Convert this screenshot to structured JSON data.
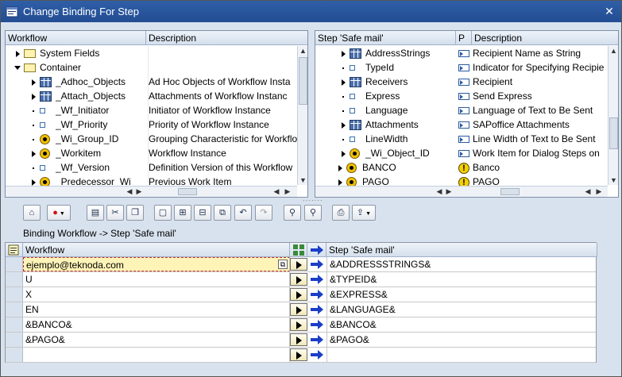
{
  "window": {
    "title": "Change Binding For Step"
  },
  "left_tree": {
    "columns": [
      "Workflow",
      "Description"
    ],
    "rows": [
      {
        "icon": "folder",
        "expander": "collapsed",
        "indent": 1,
        "name": "System Fields",
        "desc": ""
      },
      {
        "icon": "folder",
        "expander": "expanded",
        "indent": 1,
        "name": "Container",
        "desc": ""
      },
      {
        "icon": "table",
        "expander": "collapsed",
        "indent": 2,
        "name": "_Adhoc_Objects",
        "desc": "Ad Hoc Objects of Workflow Insta"
      },
      {
        "icon": "table",
        "expander": "collapsed",
        "indent": 2,
        "name": "_Attach_Objects",
        "desc": "Attachments of Workflow Instanc"
      },
      {
        "icon": "element",
        "expander": "leaf",
        "indent": 2,
        "name": "_Wf_Initiator",
        "desc": "Initiator of Workflow Instance"
      },
      {
        "icon": "element",
        "expander": "leaf",
        "indent": 2,
        "name": "_Wf_Priority",
        "desc": "Priority of Workflow Instance"
      },
      {
        "icon": "object",
        "expander": "leaf",
        "indent": 2,
        "name": "_Wi_Group_ID",
        "desc": "Grouping Characteristic for Workflo"
      },
      {
        "icon": "object",
        "expander": "collapsed",
        "indent": 2,
        "name": "_Workitem",
        "desc": "Workflow Instance"
      },
      {
        "icon": "element",
        "expander": "leaf",
        "indent": 2,
        "name": "_Wf_Version",
        "desc": "Definition Version of this Workflow"
      },
      {
        "icon": "object",
        "expander": "collapsed",
        "indent": 2,
        "name": "_Predecessor_Wi",
        "desc": "Previous Work Item"
      }
    ]
  },
  "right_tree": {
    "columns": [
      "Step 'Safe mail'",
      "P",
      "Description"
    ],
    "rows": [
      {
        "icon": "table",
        "expander": "collapsed",
        "indent": 2,
        "name": "AddressStrings",
        "p": "param",
        "desc": "Recipient Name as String"
      },
      {
        "icon": "element",
        "expander": "leaf",
        "indent": 2,
        "name": "TypeId",
        "p": "param",
        "desc": "Indicator for Specifying Recipie"
      },
      {
        "icon": "table",
        "expander": "collapsed",
        "indent": 2,
        "name": "Receivers",
        "p": "param",
        "desc": "Recipient"
      },
      {
        "icon": "element",
        "expander": "leaf",
        "indent": 2,
        "name": "Express",
        "p": "param",
        "desc": "Send Express"
      },
      {
        "icon": "element",
        "expander": "leaf",
        "indent": 2,
        "name": "Language",
        "p": "param",
        "desc": "Language of Text to Be Sent"
      },
      {
        "icon": "table",
        "expander": "collapsed",
        "indent": 2,
        "name": "Attachments",
        "p": "param",
        "desc": "SAPoffice Attachments"
      },
      {
        "icon": "element",
        "expander": "leaf",
        "indent": 2,
        "name": "LineWidth",
        "p": "param",
        "desc": "Line Width of Text to Be Sent"
      },
      {
        "icon": "object",
        "expander": "collapsed",
        "indent": 2,
        "name": "_Wi_Object_ID",
        "p": "param",
        "desc": "Work Item for Dialog Steps on"
      },
      {
        "icon": "object",
        "expander": "collapsed",
        "indent": 1,
        "name": "BANCO",
        "p": "warn",
        "desc": "Banco"
      },
      {
        "icon": "object",
        "expander": "collapsed",
        "indent": 1,
        "name": "PAGO",
        "p": "warn",
        "desc": "PAGO"
      }
    ]
  },
  "binding": {
    "label": "Binding Workflow  -> Step 'Safe mail'",
    "col_left": "Workflow",
    "col_right": "Step 'Safe mail'",
    "rows": [
      {
        "left": "ejemplo@teknoda.com",
        "right": "&ADDRESSSTRINGS&"
      },
      {
        "left": "U",
        "right": "&TYPEID&"
      },
      {
        "left": "X",
        "right": "&EXPRESS&"
      },
      {
        "left": "EN",
        "right": "&LANGUAGE&"
      },
      {
        "left": "&BANCO&",
        "right": "&BANCO&"
      },
      {
        "left": "&PAGO&",
        "right": "&PAGO&"
      },
      {
        "left": "",
        "right": ""
      }
    ]
  },
  "toolbar": {
    "buttons": [
      "tree-icon",
      "stop-icon",
      "clipboard-icon",
      "scissors-icon",
      "copy-icon",
      "new-icon",
      "insert-row-icon",
      "delete-row-icon",
      "copy-row-icon",
      "undo-icon",
      "redo-icon",
      "binoculars-icon",
      "find-next-icon",
      "print-icon",
      "export-icon"
    ]
  }
}
